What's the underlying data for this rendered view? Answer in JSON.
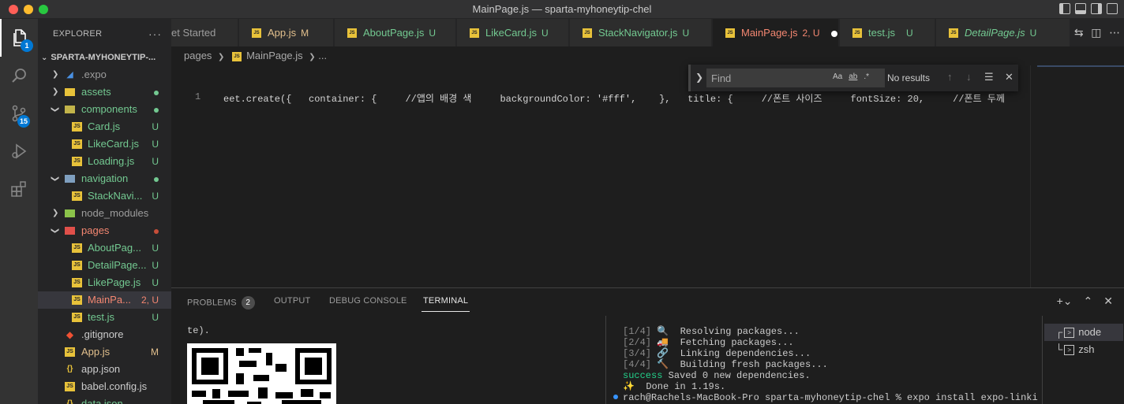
{
  "window": {
    "title": "MainPage.js — sparta-myhoneytip-chel"
  },
  "activity": {
    "explorer_badge": "1",
    "scm_badge": "15"
  },
  "sidebar": {
    "title": "EXPLORER",
    "more": "···",
    "project": "SPARTA-MYHONEYTIP-...",
    "items": [
      {
        "label": ".expo",
        "status": ""
      },
      {
        "label": "assets",
        "status": ""
      },
      {
        "label": "components",
        "status": ""
      },
      {
        "label": "Card.js",
        "status": "U"
      },
      {
        "label": "LikeCard.js",
        "status": "U"
      },
      {
        "label": "Loading.js",
        "status": "U"
      },
      {
        "label": "navigation",
        "status": ""
      },
      {
        "label": "StackNavi...",
        "status": "U"
      },
      {
        "label": "node_modules",
        "status": ""
      },
      {
        "label": "pages",
        "status": ""
      },
      {
        "label": "AboutPag...",
        "status": "U"
      },
      {
        "label": "DetailPage...",
        "status": "U"
      },
      {
        "label": "LikePage.js",
        "status": "U"
      },
      {
        "label": "MainPa...",
        "status": "2, U"
      },
      {
        "label": "test.js",
        "status": "U"
      },
      {
        "label": ".gitignore",
        "status": ""
      },
      {
        "label": "App.js",
        "status": "M"
      },
      {
        "label": "app.json",
        "status": ""
      },
      {
        "label": "babel.config.js",
        "status": ""
      },
      {
        "label": "data.json",
        "status": ""
      }
    ]
  },
  "tabs": [
    {
      "label": "et Started",
      "status": ""
    },
    {
      "label": "App.js",
      "status": "M"
    },
    {
      "label": "AboutPage.js",
      "status": "U"
    },
    {
      "label": "LikeCard.js",
      "status": "U"
    },
    {
      "label": "StackNavigator.js",
      "status": "U"
    },
    {
      "label": "MainPage.js",
      "status": "2, U"
    },
    {
      "label": "test.js",
      "status": "U"
    },
    {
      "label": "DetailPage.js",
      "status": "U"
    }
  ],
  "breadcrumb": {
    "folder": "pages",
    "file": "MainPage.js",
    "tail": "..."
  },
  "editor": {
    "line_number": "1",
    "code": "eet.create({   container: {     //앱의 배경 색     backgroundColor: '#fff',    },   title: {     //폰트 사이즈     fontSize: 20,     //폰트 두께     fo"
  },
  "find": {
    "placeholder": "Find",
    "value": "",
    "result": "No results",
    "opt_case": "Aa",
    "opt_word": "ab",
    "opt_regex": ".*"
  },
  "panel": {
    "tabs": [
      "PROBLEMS",
      "OUTPUT",
      "DEBUG CONSOLE",
      "TERMINAL"
    ],
    "problems_count": "2",
    "terminal_left": "te).",
    "terminal_lines": [
      {
        "step": "[1/4]",
        "emoji": "🔍",
        "text": "Resolving packages..."
      },
      {
        "step": "[2/4]",
        "emoji": "🚚",
        "text": "Fetching packages..."
      },
      {
        "step": "[3/4]",
        "emoji": "🔗",
        "text": "Linking dependencies..."
      },
      {
        "step": "[4/4]",
        "emoji": "🔨",
        "text": "Building fresh packages..."
      }
    ],
    "success_word": "success",
    "success_rest": "Saved 0 new dependencies.",
    "done": "✨  Done in 1.19s.",
    "prompt": "rach@Rachels-MacBook-Pro sparta-myhoneytip-chel % expo install expo-linki",
    "terminals": [
      "node",
      "zsh"
    ]
  }
}
